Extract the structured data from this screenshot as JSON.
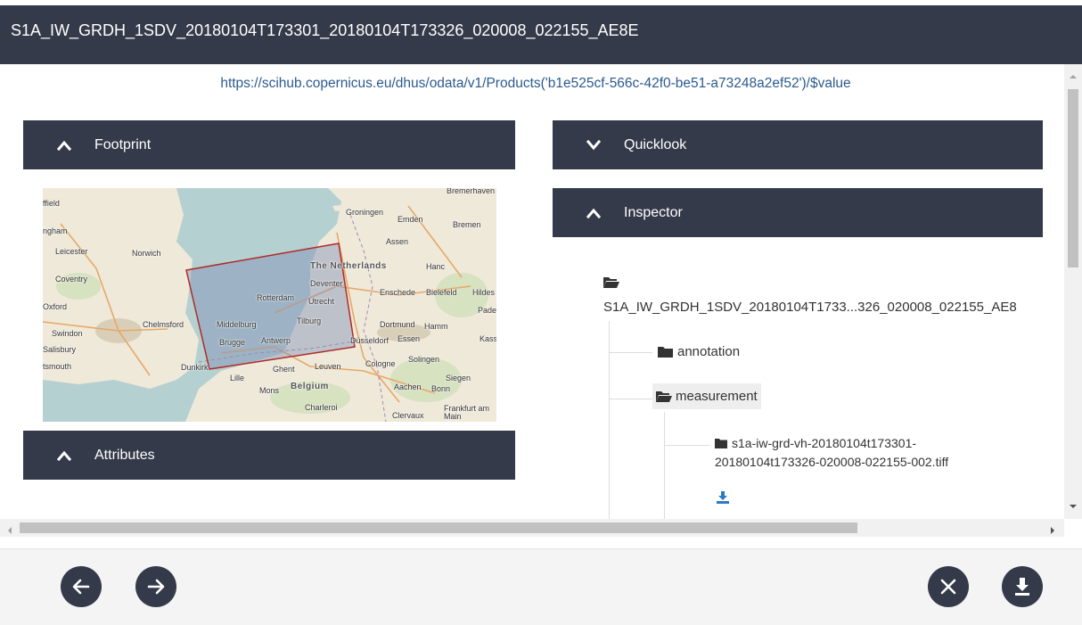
{
  "header": {
    "title": "S1A_IW_GRDH_1SDV_20180104T173301_20180104T173326_020008_022155_AE8E"
  },
  "product_url": "https://scihub.copernicus.eu/dhus/odata/v1/Products('b1e525cf-566c-42f0-be51-a73248a2ef52')/$value",
  "panels": {
    "footprint": {
      "label": "Footprint",
      "state": "expanded"
    },
    "quicklook": {
      "label": "Quicklook",
      "state": "collapsed"
    },
    "inspector": {
      "label": "Inspector",
      "state": "expanded"
    },
    "attributes": {
      "label": "Attributes",
      "state": "expanded"
    }
  },
  "map": {
    "labels": {
      "bremerhaven": "Bremerhaven",
      "groningen": "Groningen",
      "emden": "Emden",
      "bremen": "Bremen",
      "assen": "Assen",
      "ffield": "ffield",
      "ngham": "ngham",
      "leicester": "Leicester",
      "norwich": "Norwich",
      "coventry": "Coventry",
      "netherlands": "The Netherlands",
      "deventer": "Deventer",
      "enschede": "Enschede",
      "bielefeld": "Bielefeld",
      "hildes": "Hildes",
      "hanc": "Hanc",
      "pade": "Pade",
      "oxford": "Oxford",
      "chelmsford": "Chelmsford",
      "rotterdam": "Rotterdam",
      "utrecht": "Utrecht",
      "swindon": "Swindon",
      "middelburg": "Middelburg",
      "tilburg": "Tilburg",
      "dortmund": "Dortmund",
      "hamm": "Hamm",
      "salisbury": "Salisbury",
      "brugge": "Brugge",
      "antwerp": "Antwerp",
      "dusseldorf": "Düsseldorf",
      "essen": "Essen",
      "kass": "Kass",
      "tsmouth": "tsmouth",
      "dunkirk": "Dunkirk",
      "ghent": "Ghent",
      "leuven": "Leuven",
      "cologne": "Cologne",
      "solingen": "Solingen",
      "lille": "Lille",
      "siegen": "Siegen",
      "mons": "Mons",
      "belgium": "Belgium",
      "aachen": "Aachen",
      "bonn": "Bonn",
      "charleroi": "Charleroi",
      "clervaux": "Clervaux",
      "frankfurt": "Frankfurt am Main"
    }
  },
  "inspector_tree": {
    "root": "S1A_IW_GRDH_1SDV_20180104T1733...326_020008_022155_AE8",
    "nodes": {
      "annotation": "annotation",
      "measurement": "measurement"
    },
    "file_line1": "s1a-iw-grd-vh-20180104t173301-",
    "file_line2": "20180104t173326-020008-022155-002.tiff"
  },
  "icons": {
    "chevron_up": "chevron-up-icon",
    "chevron_down": "chevron-down-icon",
    "folder_open": "folder-open-icon",
    "folder": "folder-icon",
    "download": "download-icon",
    "arrow_left": "arrow-left-icon",
    "arrow_right": "arrow-right-icon",
    "close": "close-icon"
  },
  "colors": {
    "bar_background": "#353a4a",
    "link": "#2c5a8f",
    "footprint_outline": "#b02a2a",
    "download_icon": "#2b7bc4"
  }
}
